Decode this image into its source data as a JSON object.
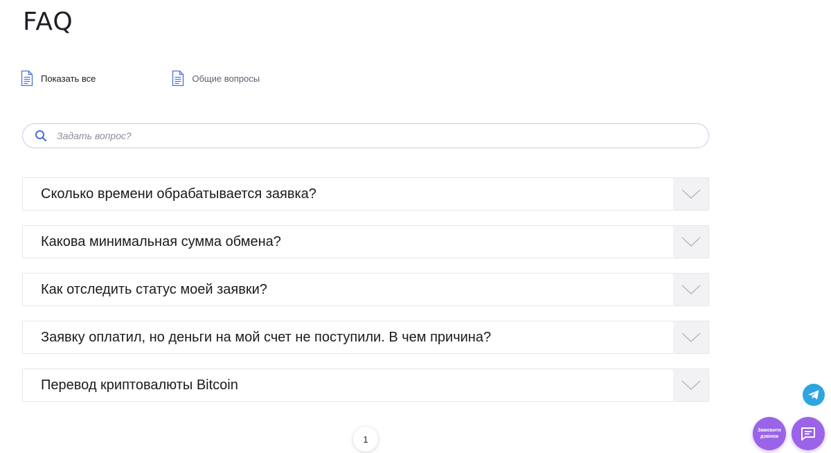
{
  "page": {
    "title": "FAQ"
  },
  "filters": [
    {
      "label": "Показать все",
      "icon": "document-icon",
      "active": true
    },
    {
      "label": "Общие вопросы",
      "icon": "document-icon",
      "active": false
    }
  ],
  "search": {
    "placeholder": "Задать вопрос?",
    "value": "",
    "icon": "search-icon"
  },
  "faq": {
    "items": [
      {
        "question": "Сколько времени обрабатывается заявка?"
      },
      {
        "question": "Какова минимальная сумма обмена?"
      },
      {
        "question": "Как отследить статус моей заявки?"
      },
      {
        "question": "Заявку оплатил, но деньги на мой счет не поступили. В чем причина?"
      },
      {
        "question": "Перевод криптовалюты Bitcoin"
      }
    ]
  },
  "pagination": {
    "current": "1"
  },
  "widgets": {
    "callback_label": "Замовити дзвінок",
    "telegram_icon": "telegram-icon",
    "chat_icon": "chat-icon"
  },
  "colors": {
    "accent_purple": "#9a63e8",
    "telegram_blue": "#2ca5e0",
    "icon_blue": "#4a6fd8",
    "toggle_bg": "#f2f2f4"
  }
}
